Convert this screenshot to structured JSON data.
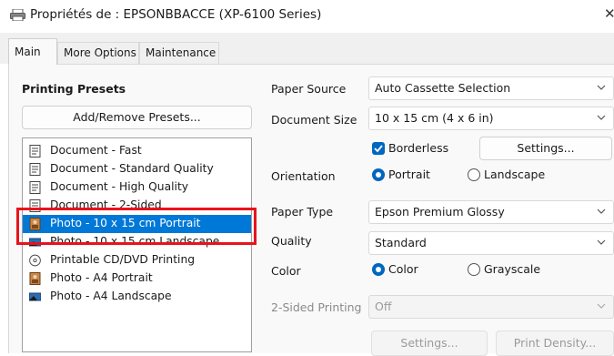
{
  "window": {
    "title": "Propriétés de : EPSONBBACCE (XP-6100 Series)",
    "close_glyph": "✕"
  },
  "tabs": [
    {
      "label": "Main",
      "active": true
    },
    {
      "label": "More Options",
      "active": false
    },
    {
      "label": "Maintenance",
      "active": false
    }
  ],
  "presets": {
    "heading": "Printing Presets",
    "add_remove_label": "Add/Remove Presets...",
    "items": [
      {
        "label": "Document - Fast",
        "icon": "document-icon"
      },
      {
        "label": "Document - Standard Quality",
        "icon": "document-icon"
      },
      {
        "label": "Document - High Quality",
        "icon": "document-icon"
      },
      {
        "label": "Document - 2-Sided",
        "icon": "document-icon"
      },
      {
        "label": "Photo - 10 x 15 cm Portrait",
        "icon": "photo-portrait-icon",
        "selected": true
      },
      {
        "label": "Photo - 10 x 15 cm Landscape",
        "icon": "photo-landscape-icon"
      },
      {
        "label": "Printable CD/DVD Printing",
        "icon": "cd-icon"
      },
      {
        "label": "Photo - A4 Portrait",
        "icon": "photo-portrait-icon"
      },
      {
        "label": "Photo - A4 Landscape",
        "icon": "photo-landscape-icon"
      }
    ]
  },
  "settings": {
    "paper_source": {
      "label": "Paper Source",
      "value": "Auto Cassette Selection"
    },
    "document_size": {
      "label": "Document Size",
      "value": "10 x 15 cm (4 x 6 in)"
    },
    "borderless": {
      "label": "Borderless",
      "checked": true
    },
    "borderless_settings_label": "Settings...",
    "orientation": {
      "label": "Orientation",
      "options": [
        "Portrait",
        "Landscape"
      ],
      "selected": "Portrait"
    },
    "paper_type": {
      "label": "Paper Type",
      "value": "Epson Premium Glossy"
    },
    "quality": {
      "label": "Quality",
      "value": "Standard"
    },
    "color": {
      "label": "Color",
      "options": [
        "Color",
        "Grayscale"
      ],
      "selected": "Color"
    },
    "two_sided": {
      "label": "2-Sided Printing",
      "value": "Off",
      "disabled": true
    },
    "two_sided_settings_label": "Settings...",
    "print_density_label": "Print Density..."
  },
  "colors": {
    "selection": "#0078d7",
    "accent": "#0067c0",
    "highlight_box": "#e8131b"
  }
}
